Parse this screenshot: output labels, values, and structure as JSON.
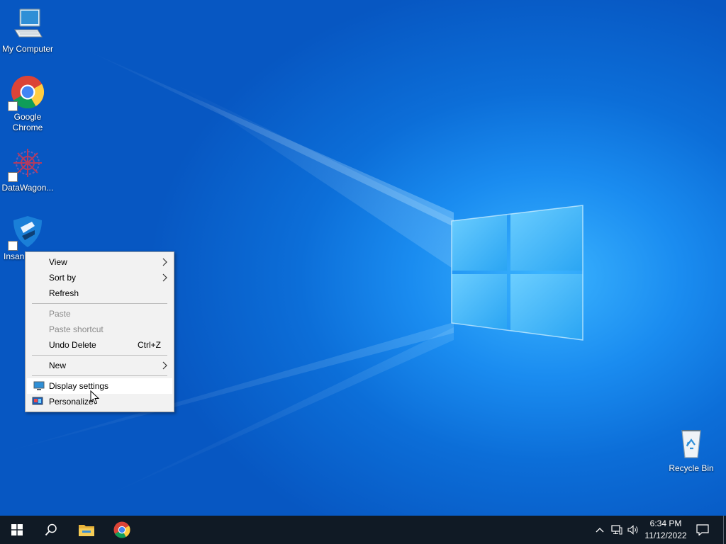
{
  "desktop": {
    "icons": [
      {
        "label": "My Computer"
      },
      {
        "label": "Google Chrome"
      },
      {
        "label": "DataWagon..."
      },
      {
        "label": "Insan"
      },
      {
        "label": "Recycle Bin"
      }
    ]
  },
  "context_menu": {
    "items": [
      {
        "label": "View"
      },
      {
        "label": "Sort by"
      },
      {
        "label": "Refresh"
      },
      {
        "label": "Paste",
        "disabled": true
      },
      {
        "label": "Paste shortcut",
        "disabled": true
      },
      {
        "label": "Undo Delete",
        "shortcut": "Ctrl+Z"
      },
      {
        "label": "New"
      },
      {
        "label": "Display settings",
        "highlighted": true
      },
      {
        "label": "Personalize"
      }
    ]
  },
  "taskbar": {
    "clock": {
      "time": "6:34 PM",
      "date": "11/12/2022"
    },
    "pinned": [
      "start-icon",
      "search-icon",
      "file-explorer-icon",
      "chrome-icon"
    ],
    "tray": [
      "chevron-up-icon",
      "network-icon",
      "volume-icon",
      "notification-icon"
    ]
  },
  "colors": {
    "desktop_background": "#0c6ed8",
    "taskbar": "#101a25",
    "menu_background": "#f2f2f2",
    "menu_highlight": "#ffffff",
    "disabled_text": "#8a8a8a"
  }
}
